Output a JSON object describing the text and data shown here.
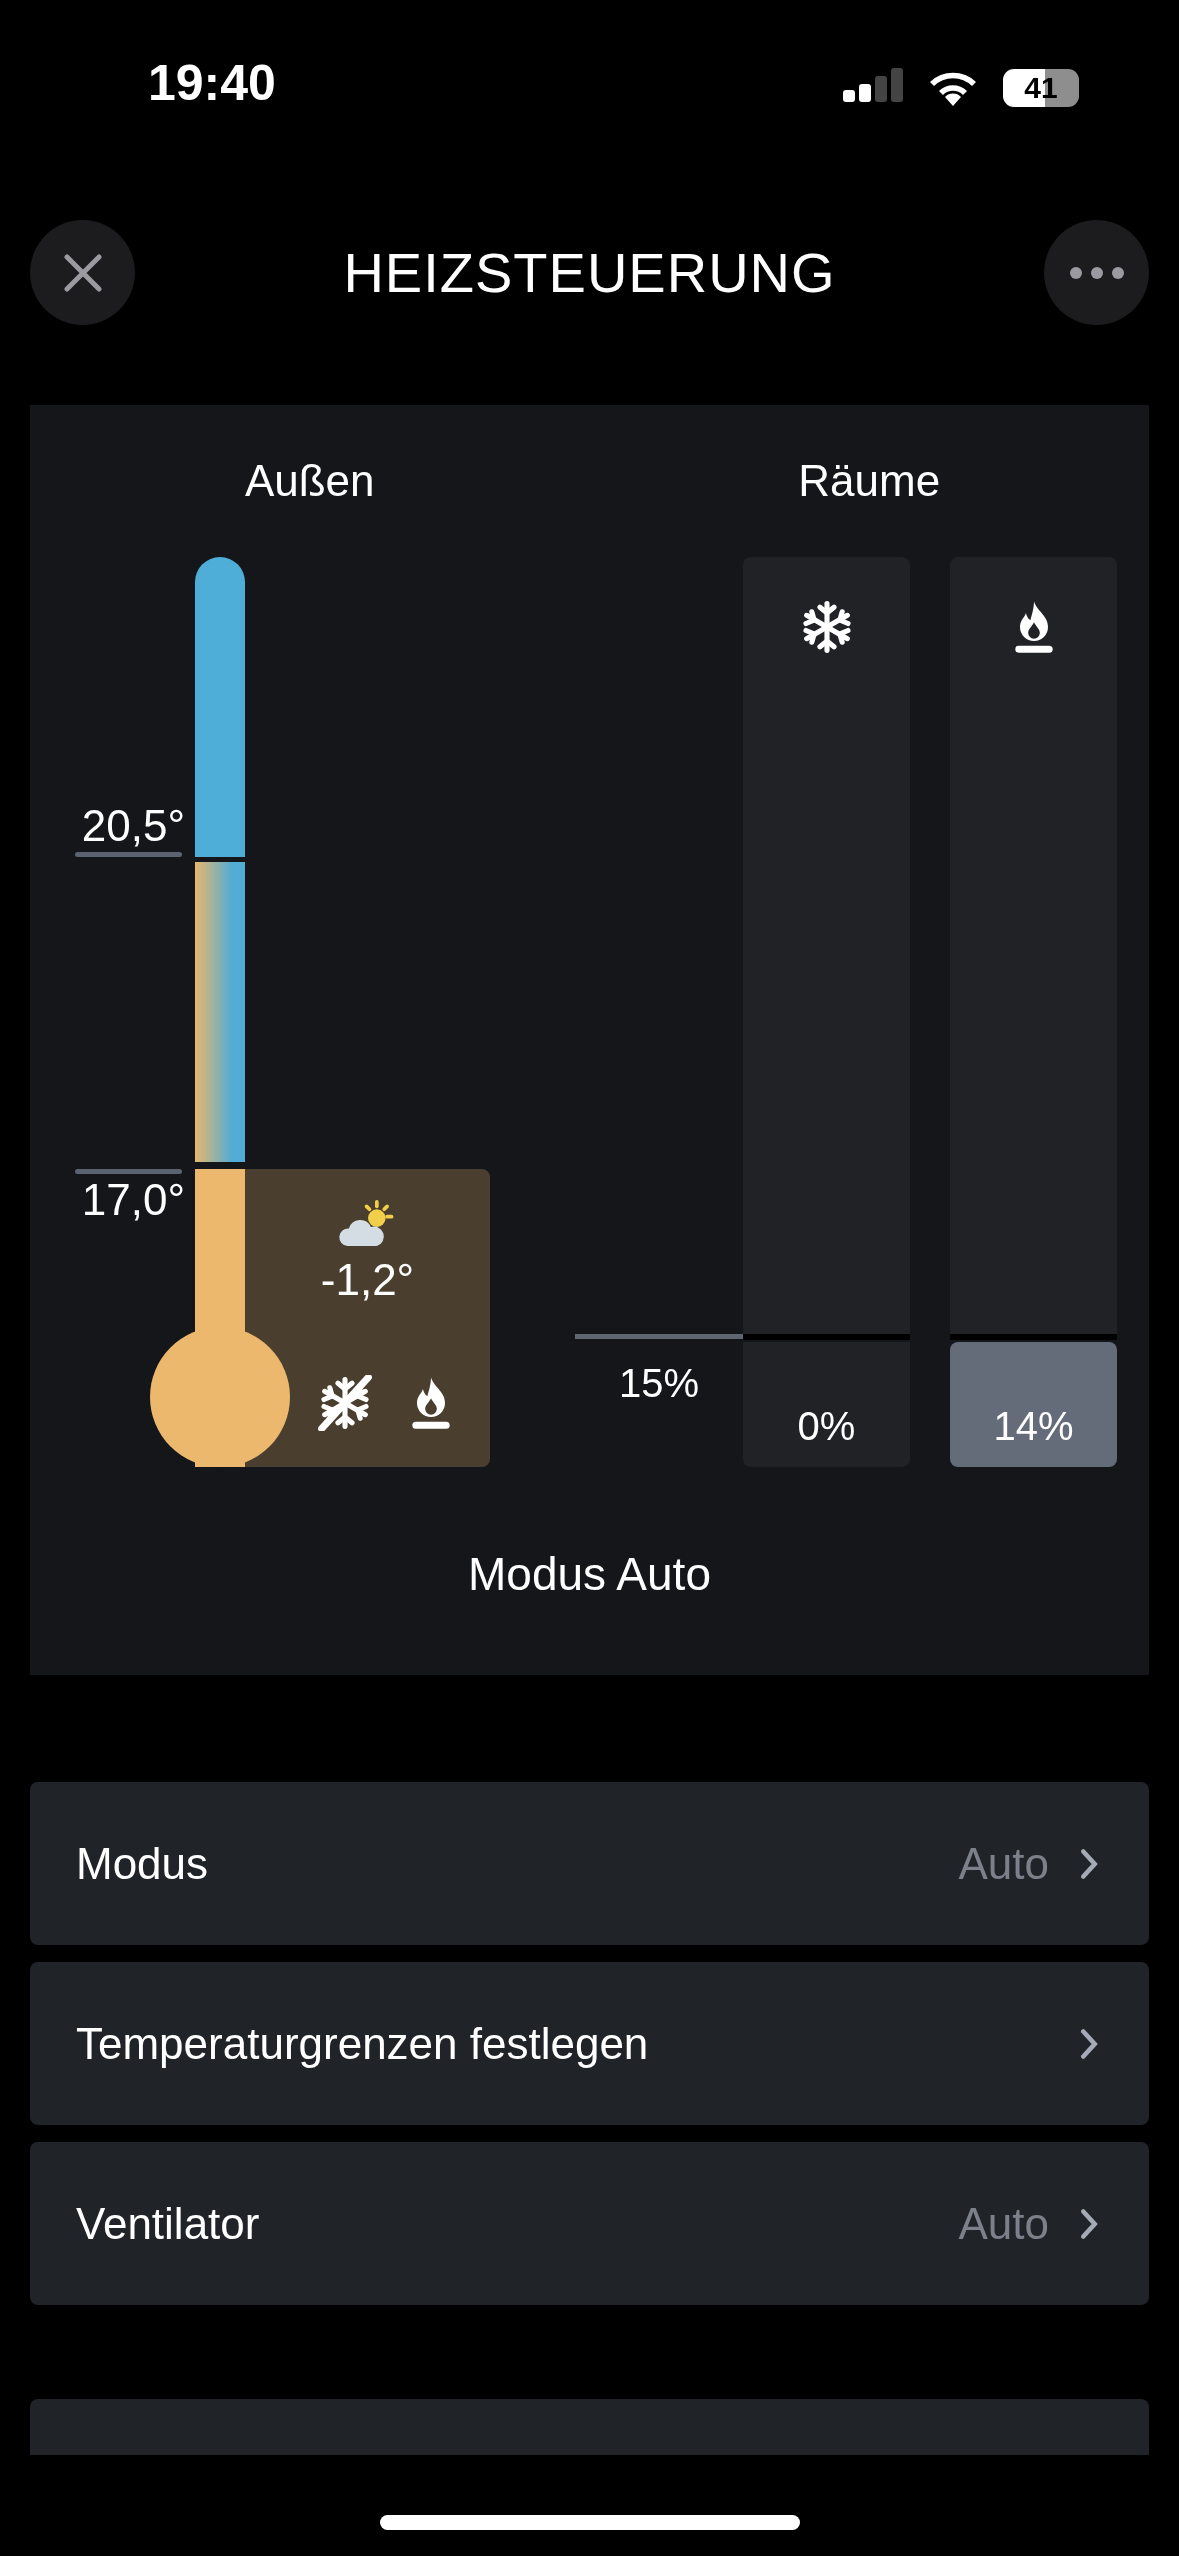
{
  "status_bar": {
    "time": "19:40",
    "battery": "41"
  },
  "header": {
    "title": "HEIZSTEUERUNG"
  },
  "outside": {
    "title": "Außen",
    "upper_limit": "20,5°",
    "lower_limit": "17,0°",
    "temperature": "-1,2°",
    "cooling_enabled": false,
    "heating_enabled": true
  },
  "rooms": {
    "title": "Räume",
    "threshold": "15%",
    "columns": [
      {
        "kind": "cooling",
        "reading": "0%",
        "active": false
      },
      {
        "kind": "heating",
        "reading": "14%",
        "active": true
      }
    ]
  },
  "mode_caption": "Modus Auto",
  "settings": [
    {
      "label": "Modus",
      "value": "Auto"
    },
    {
      "label": "Temperaturgrenzen festlegen"
    },
    {
      "label": "Ventilator",
      "value": "Auto"
    }
  ]
}
